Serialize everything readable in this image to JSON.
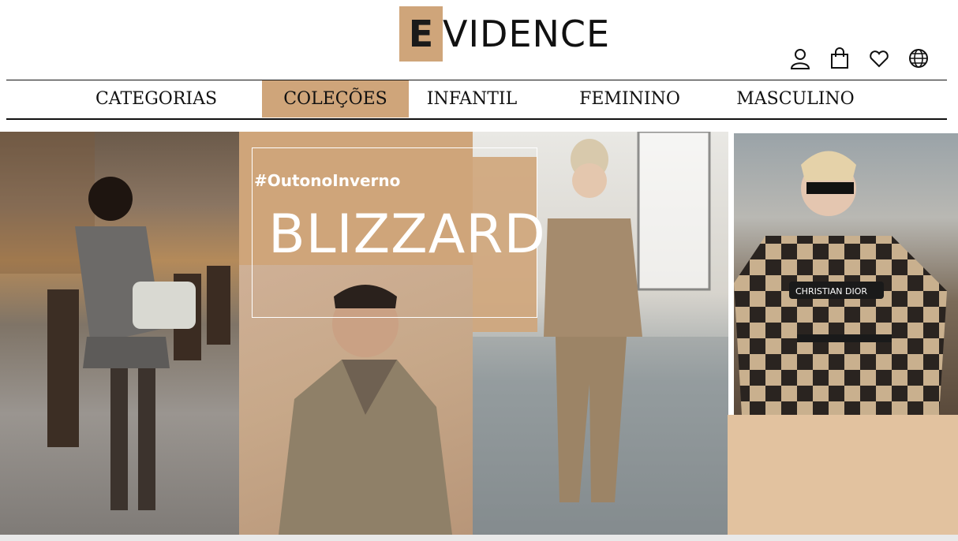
{
  "brand": {
    "logo_initial": "E",
    "logo_rest": "VIDENCE"
  },
  "header_icons": [
    "user-icon",
    "shopping-bag-icon",
    "heart-icon",
    "globe-icon"
  ],
  "nav": {
    "items": [
      {
        "label": "CATEGORIAS",
        "active": false
      },
      {
        "label": "COLEÇÕES",
        "active": true
      },
      {
        "label": "INFANTIL",
        "active": false
      },
      {
        "label": "FEMININO",
        "active": false
      },
      {
        "label": "MASCULINO",
        "active": false
      }
    ]
  },
  "hero": {
    "hashtag": "#OutonoInverno",
    "title": "BLIZZARD",
    "badge_text": "CHRISTIAN DIOR"
  },
  "colors": {
    "accent": "#cfa57a",
    "accent_light": "#e2c29f",
    "text": "#111111"
  }
}
